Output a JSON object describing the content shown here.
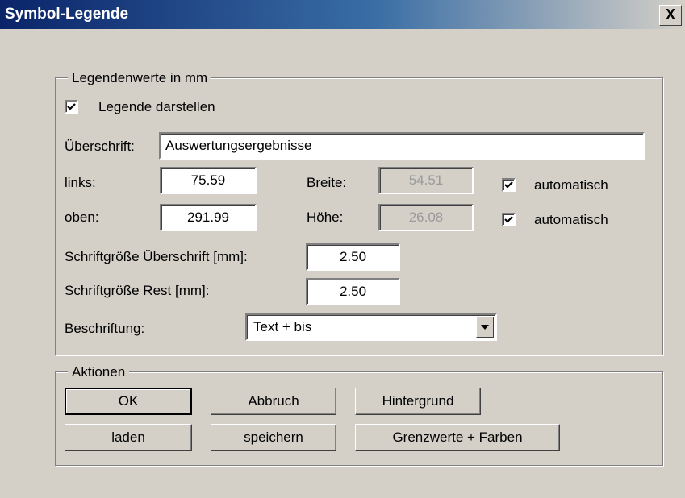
{
  "window": {
    "title": "Symbol-Legende",
    "close_label": "X"
  },
  "legend_group": {
    "title": "Legendenwerte in mm",
    "show_legend_label": "Legende darstellen",
    "show_legend_checked": true,
    "heading_label": "Überschrift:",
    "heading_value": "Auswertungsergebnisse",
    "left_label": "links:",
    "left_value": "75.59",
    "top_label": "oben:",
    "top_value": "291.99",
    "width_label": "Breite:",
    "width_value": "54.51",
    "height_label": "Höhe:",
    "height_value": "26.08",
    "auto_width_label": "automatisch",
    "auto_width_checked": true,
    "auto_height_label": "automatisch",
    "auto_height_checked": true,
    "heading_font_label": "Schriftgröße Überschrift [mm]:",
    "heading_font_value": "2.50",
    "rest_font_label": "Schriftgröße Rest [mm]:",
    "rest_font_value": "2.50",
    "caption_label": "Beschriftung:",
    "caption_value": "Text + bis"
  },
  "actions_group": {
    "title": "Aktionen",
    "ok": "OK",
    "cancel": "Abbruch",
    "background": "Hintergrund",
    "load": "laden",
    "save": "speichern",
    "limits_colors": "Grenzwerte + Farben"
  }
}
